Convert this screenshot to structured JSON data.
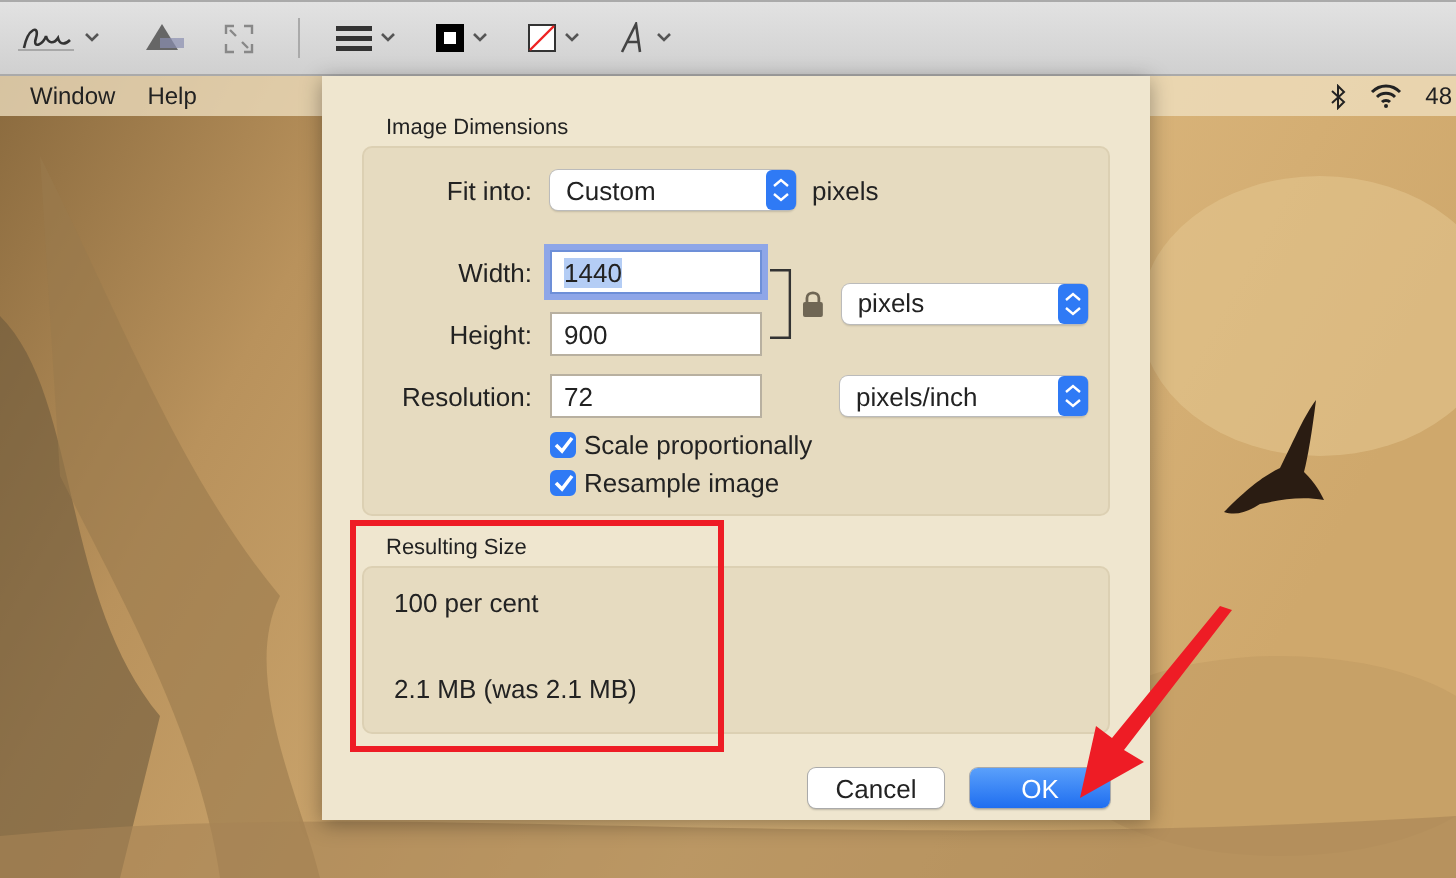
{
  "menu_bar": {
    "items": [
      "Window",
      "Help"
    ],
    "battery": "48"
  },
  "dialog": {
    "section_title": "Image Dimensions",
    "fit_into": {
      "label": "Fit into:",
      "value": "Custom",
      "unit": "pixels"
    },
    "size_fields": [
      {
        "label": "Width:",
        "value": "1440",
        "focused": true
      },
      {
        "label": "Height:",
        "value": "900",
        "focused": false
      }
    ],
    "size_unit": "pixels",
    "resolution": {
      "label": "Resolution:",
      "value": "72",
      "focused": false
    },
    "resolution_unit": "pixels/inch",
    "checkboxes": [
      {
        "label": "Scale proportionally",
        "checked": true
      },
      {
        "label": "Resample image",
        "checked": true
      }
    ],
    "result_title": "Resulting Size",
    "result_lines": [
      "100 per cent",
      "2.1 MB (was 2.1 MB)"
    ],
    "buttons": [
      {
        "label": "Cancel",
        "kind": "default"
      },
      {
        "label": "OK",
        "kind": "primary"
      }
    ]
  }
}
